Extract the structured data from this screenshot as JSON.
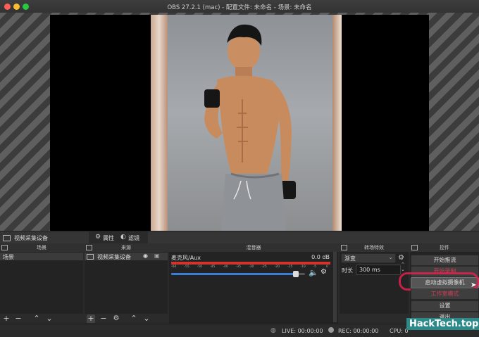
{
  "window": {
    "title": "OBS 27.2.1 (mac) - 配置文件: 未命名 - 场景: 未命名"
  },
  "source_bar": {
    "selected_source": "视频采集设备",
    "properties_label": "属性",
    "filters_label": "滤镜"
  },
  "docks": {
    "scenes": "场景",
    "sources": "来源",
    "mixer": "混音器",
    "transitions": "转场特效",
    "controls": "控件"
  },
  "scenes": {
    "items": [
      "场景"
    ]
  },
  "sources": {
    "items": [
      "视频采集设备"
    ]
  },
  "mixer": {
    "channel_name": "麦克风/Aux",
    "level_readout": "0.0 dB",
    "scale_ticks": [
      "-60",
      "-55",
      "-50",
      "-45",
      "-40",
      "-35",
      "-30",
      "-25",
      "-20",
      "-15",
      "-10",
      "-5",
      "0"
    ],
    "volume_level": 0.93
  },
  "transitions": {
    "type": "渐变",
    "duration_label": "时长",
    "duration_value": "300 ms"
  },
  "controls": {
    "start_streaming": "开始推流",
    "start_recording": "开始录制",
    "start_virtual_camera": "启动虚拟摄像机",
    "studio_mode": "工作室模式",
    "settings": "设置",
    "exit": "退出"
  },
  "status": {
    "live": "LIVE: 00:00:00",
    "rec": "REC: 00:00:00",
    "cpu": "CPU: 0"
  },
  "watermark": "HackTech.top",
  "colors": {
    "highlight_ring": "#e0214f",
    "meter_red": "#d0352b",
    "volume_blue": "#3a7fd5"
  }
}
